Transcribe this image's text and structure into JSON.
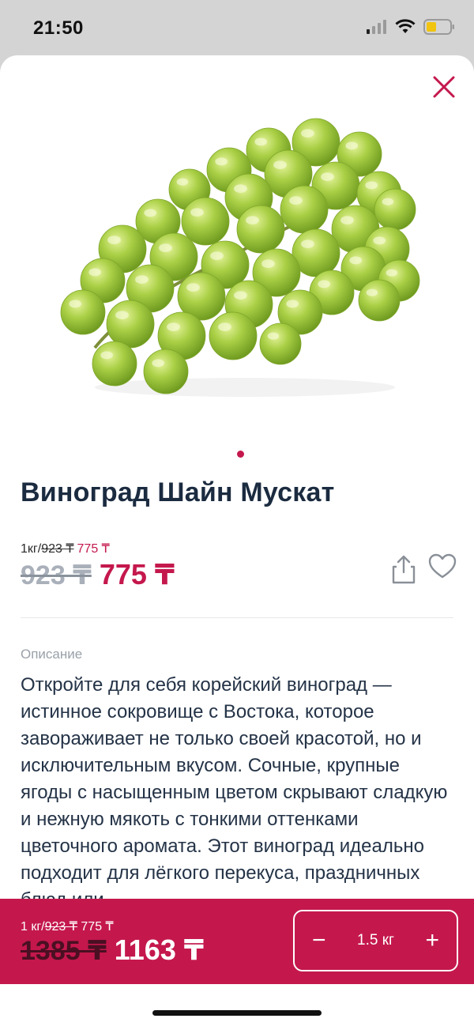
{
  "status": {
    "time": "21:50"
  },
  "product": {
    "title": "Виноград Шайн Мускат",
    "unit_prefix": "1кг/",
    "unit_price_old": "923 ₸",
    "unit_price_new": "775 ₸",
    "price_old": "923 ₸",
    "price_new": "775 ₸"
  },
  "description": {
    "label": "Описание",
    "text": "Откройте для себя корейский виноград — истинное сокровище с Востока, которое завораживает не только своей красотой, но и исключительным вкусом. Сочные, крупные ягоды с насыщенным цветом скрывают сладкую и нежную мякоть с тонкими оттенками цветочного аромата. Этот виноград идеально подходит для лёгкого перекуса, праздничных блюд или"
  },
  "cart": {
    "unit_prefix": "1 кг/",
    "unit_price_old": "923 ₸",
    "unit_price_new": "775 ₸",
    "total_old": "1385 ₸",
    "total_new": "1163 ₸",
    "quantity": "1.5 кг",
    "minus": "−",
    "plus": "+"
  },
  "colors": {
    "accent": "#c4184d",
    "title": "#1b2b40",
    "grape": "#9bc43a"
  },
  "icons": [
    "signal-icon",
    "wifi-icon",
    "battery-icon",
    "close-icon",
    "share-icon",
    "heart-icon"
  ]
}
